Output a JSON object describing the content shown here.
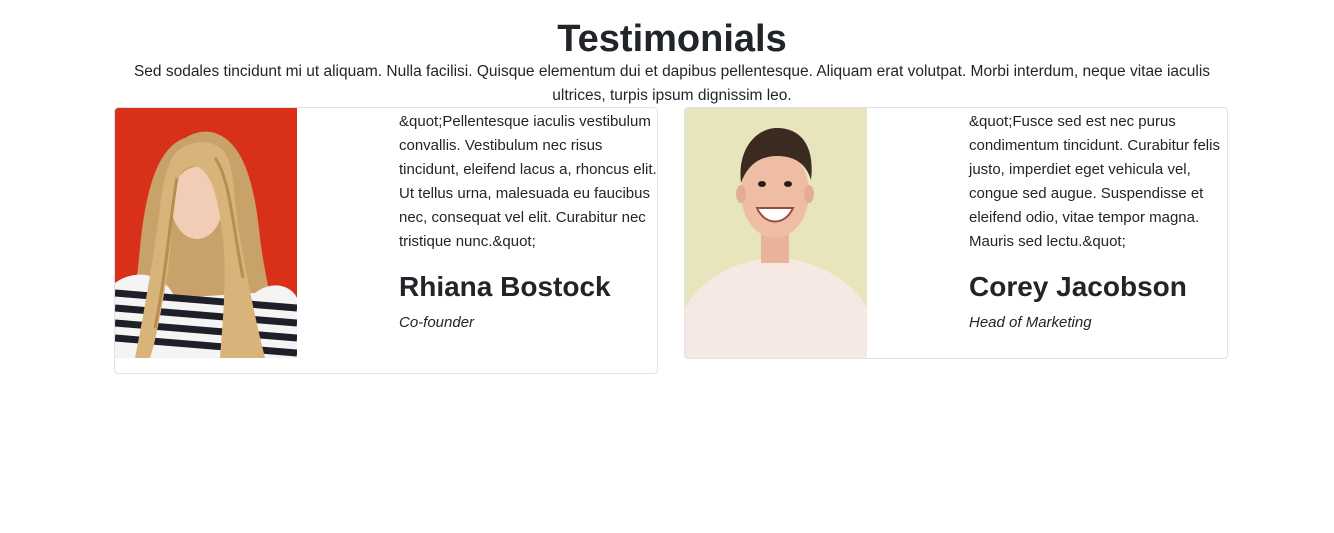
{
  "section": {
    "title": "Testimonials",
    "lead": "Sed sodales tincidunt mi ut aliquam. Nulla facilisi. Quisque elementum dui et dapibus pellentesque. Aliquam erat volutpat. Morbi interdum, neque vitae iaculis ultrices, turpis ipsum dignissim leo."
  },
  "testimonials": [
    {
      "quote": "&quot;Pellentesque iaculis vestibulum convallis. Vestibulum nec risus tincidunt, eleifend lacus a, rhoncus elit. Ut tellus urna, malesuada eu faucibus nec, consequat vel elit. Curabitur nec tristique nunc.&quot;",
      "name": "Rhiana Bostock",
      "role": "Co-founder",
      "photo_background": "#d9301a"
    },
    {
      "quote": "&quot;Fusce sed est nec purus condimentum tincidunt. Curabitur felis justo, imperdiet eget vehicula vel, congue sed augue. Suspendisse et eleifend odio, vitae tempor magna. Mauris sed lectu.&quot;",
      "name": "Corey Jacobson",
      "role": "Head of Marketing",
      "photo_background": "#e8e5bd"
    }
  ]
}
